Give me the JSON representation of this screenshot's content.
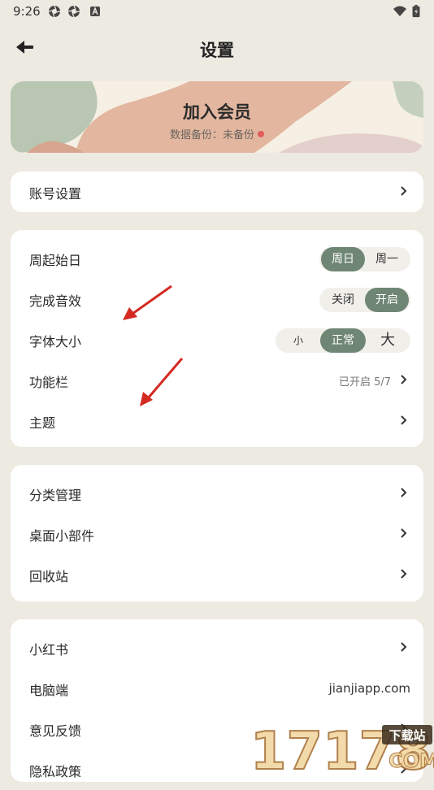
{
  "status_bar": {
    "time": "9:26"
  },
  "header": {
    "title": "设置"
  },
  "banner": {
    "title": "加入会员",
    "subtitle": "数据备份：未备份"
  },
  "account": {
    "label": "账号设置"
  },
  "preferences": {
    "week_start": {
      "label": "周起始日",
      "options": [
        "周日",
        "周一"
      ],
      "selected": "周日"
    },
    "sound": {
      "label": "完成音效",
      "options": [
        "关闭",
        "开启"
      ],
      "selected": "开启"
    },
    "font_size": {
      "label": "字体大小",
      "options": [
        "小",
        "正常",
        "大"
      ],
      "selected": "正常"
    },
    "function_bar": {
      "label": "功能栏",
      "value": "已开启 5/7"
    },
    "theme": {
      "label": "主题"
    }
  },
  "management": {
    "category": {
      "label": "分类管理"
    },
    "widgets": {
      "label": "桌面小部件"
    },
    "recycle": {
      "label": "回收站"
    }
  },
  "more": {
    "xiaohongshu": {
      "label": "小红书"
    },
    "desktop": {
      "label": "电脑端",
      "value": "jianjiapp.com"
    },
    "feedback": {
      "label": "意见反馈"
    },
    "privacy": {
      "label": "隐私政策"
    }
  },
  "watermark": {
    "number": "17178",
    "tag": "下载站",
    "domain": "COM"
  },
  "colors": {
    "background": "#edeae2",
    "accent": "#6f8674",
    "card": "#ffffff",
    "dot": "#e35d5b",
    "arrow": "#d42a22"
  }
}
